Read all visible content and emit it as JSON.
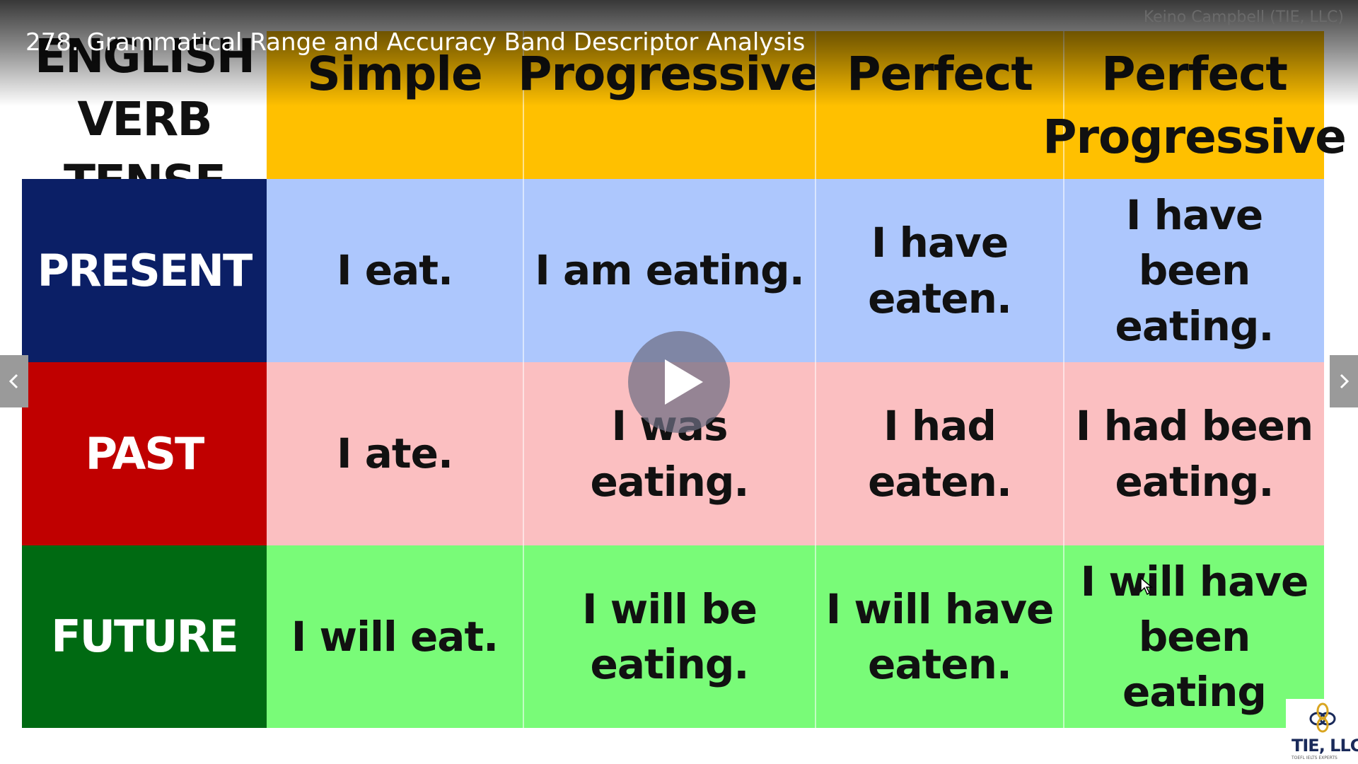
{
  "video": {
    "title": "278. Grammatical Range and Accuracy Band Descriptor Analysis",
    "channel": "Keino Campbell (TIE, LLC)"
  },
  "table": {
    "corner_label": "ENGLISH\nVERB TENSE",
    "columns": [
      "Simple",
      "Progressive",
      "Perfect",
      "Perfect\nProgressive"
    ],
    "rows": [
      {
        "label": "PRESENT",
        "cells": [
          "I eat.",
          "I am eating.",
          "I have eaten.",
          "I have been\neating."
        ]
      },
      {
        "label": "PAST",
        "cells": [
          "I ate.",
          "I was eating.",
          "I had eaten.",
          "I had been\neating."
        ]
      },
      {
        "label": "FUTURE",
        "cells": [
          "I will eat.",
          "I will be\neating.",
          "I will have\neaten.",
          "I will have\nbeen eating"
        ]
      }
    ],
    "colors": {
      "header": "#ffc000",
      "present_label": "#0b1f66",
      "past_label": "#c00000",
      "future_label": "#006a12",
      "present_row": "#adc7fd",
      "past_row": "#fbbfc1",
      "future_row": "#79fb78"
    }
  },
  "controls": {
    "play_icon": "play-icon",
    "prev_icon": "chevron-left-icon",
    "next_icon": "chevron-right-icon"
  },
  "logo": {
    "text": "TIE, LLC",
    "subtext": "TOEFL IELTS EXPERTS"
  }
}
